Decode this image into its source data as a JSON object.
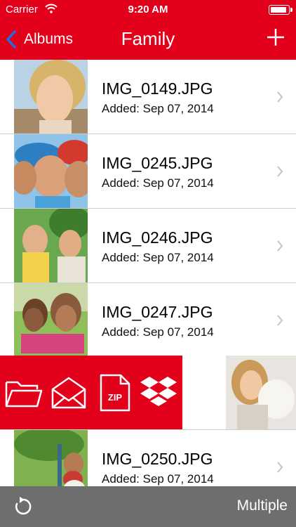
{
  "status": {
    "carrier": "Carrier",
    "time": "9:20 AM"
  },
  "nav": {
    "back_label": "Albums",
    "title": "Family"
  },
  "photos": [
    {
      "name": "IMG_0149.JPG",
      "added": "Added: Sep 07, 2014"
    },
    {
      "name": "IMG_0245.JPG",
      "added": "Added: Sep 07, 2014"
    },
    {
      "name": "IMG_0246.JPG",
      "added": "Added: Sep 07, 2014"
    },
    {
      "name": "IMG_0247.JPG",
      "added": "Added: Sep 07, 2014"
    },
    {
      "name": "IMG_0250.JPG",
      "added": "Added: Sep 07, 2014"
    }
  ],
  "swipe_actions": {
    "zip_label": "ZIP"
  },
  "toolbar": {
    "multiple_label": "Multiple"
  },
  "colors": {
    "accent": "#e3001b",
    "toolbar": "#6e6e6e",
    "separator": "#cfcfcf"
  },
  "icons": [
    "wifi-icon",
    "battery-icon",
    "chevron-left-icon",
    "plus-icon",
    "chevron-right-icon",
    "folder-icon",
    "mail-icon",
    "zip-file-icon",
    "dropbox-icon",
    "refresh-icon"
  ]
}
